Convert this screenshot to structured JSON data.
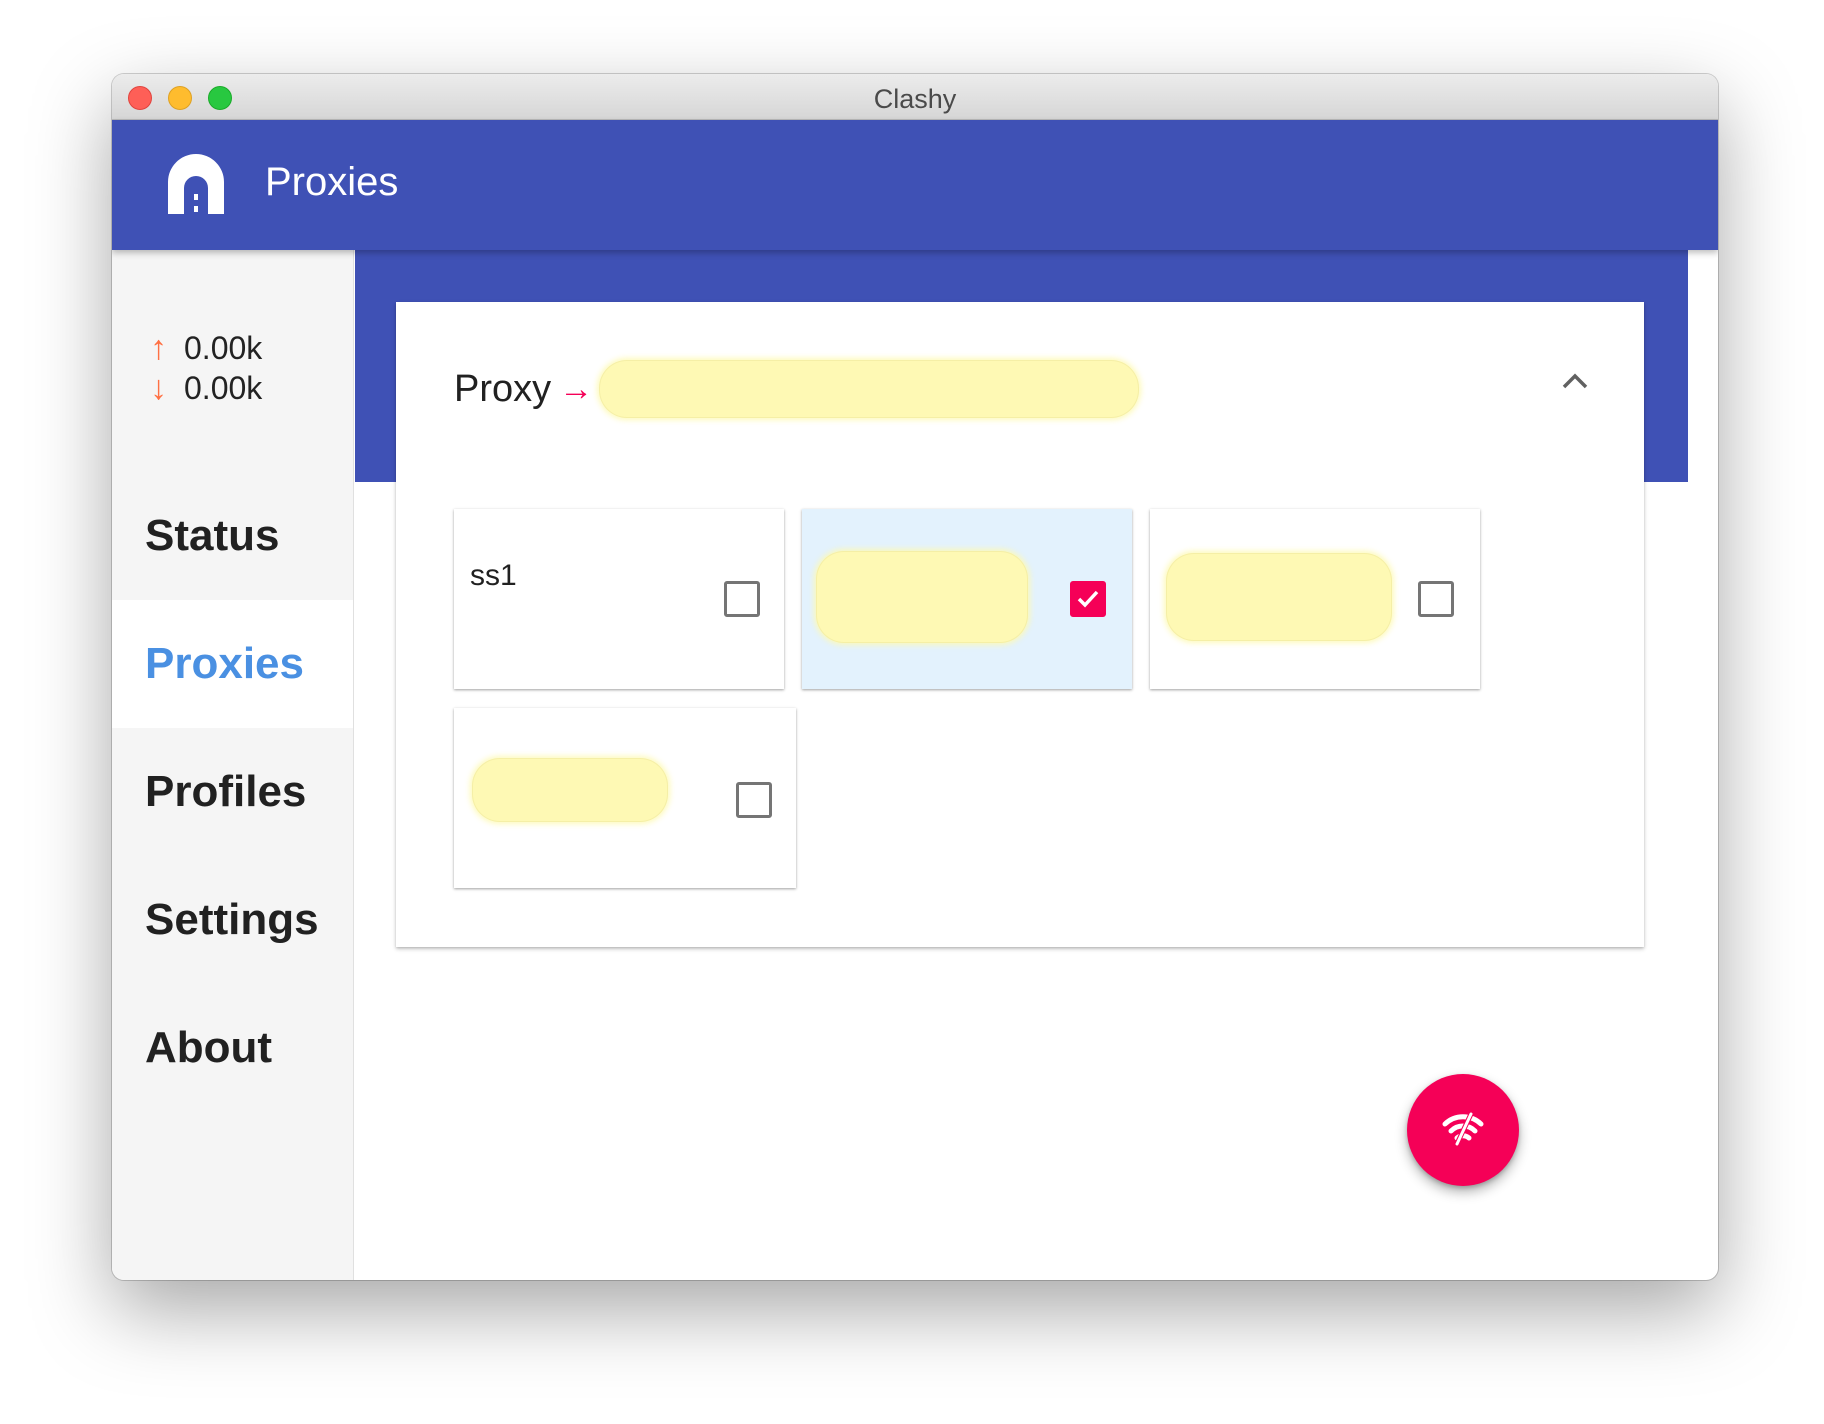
{
  "window": {
    "title": "Clashy"
  },
  "appbar": {
    "title": "Proxies",
    "color": "#3f51b5"
  },
  "speed": {
    "up": "0.00k",
    "down": "0.00k",
    "arrow_color": "#ff7043"
  },
  "nav": {
    "items": [
      {
        "label": "Status",
        "active": false
      },
      {
        "label": "Proxies",
        "active": true
      },
      {
        "label": "Profiles",
        "active": false
      },
      {
        "label": "Settings",
        "active": false
      },
      {
        "label": "About",
        "active": false
      }
    ],
    "active_color": "#4a90e2"
  },
  "proxy_group": {
    "name": "Proxy",
    "selected": "",
    "expanded": true,
    "proxies": [
      {
        "name": "ss1",
        "type": "",
        "checked": false
      },
      {
        "name": "",
        "type": "",
        "checked": true
      },
      {
        "name": "",
        "type": "",
        "checked": false
      },
      {
        "name": "",
        "type": "",
        "checked": false
      }
    ]
  },
  "accent_color": "#f50057",
  "icons": {
    "app": "tunnel-logo-icon",
    "collapse": "chevron-up-icon",
    "fab": "wifi-off-icon",
    "check": "check-icon"
  }
}
